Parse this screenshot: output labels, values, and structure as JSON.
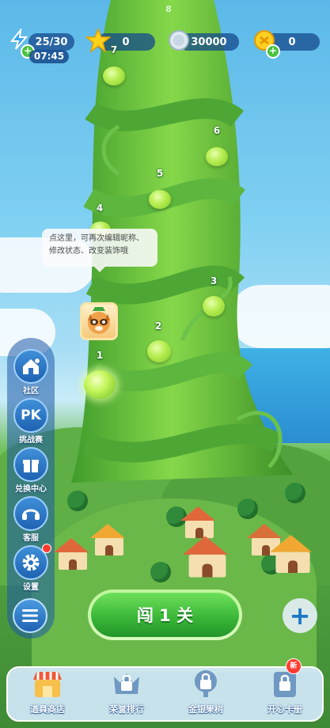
{
  "resources": {
    "energy": {
      "value": "25/30",
      "timer": "07:45",
      "icon": "lightning-icon"
    },
    "stars": {
      "value": "0",
      "icon": "star-icon"
    },
    "silver": {
      "value": "30000",
      "icon": "silver-coin-icon"
    },
    "gold": {
      "value": "0",
      "icon": "gold-coin-icon"
    }
  },
  "levels": [
    {
      "number": "1",
      "state": "current"
    },
    {
      "number": "2",
      "state": "locked"
    },
    {
      "number": "3",
      "state": "locked"
    },
    {
      "number": "4",
      "state": "locked"
    },
    {
      "number": "5",
      "state": "locked"
    },
    {
      "number": "6",
      "state": "locked"
    },
    {
      "number": "7",
      "state": "locked"
    },
    {
      "number": "8",
      "state": "locked"
    }
  ],
  "tooltip": {
    "line1": "点这里，可再次编辑昵称、",
    "line2": "修改状态、改变装饰哦"
  },
  "side_menu": [
    {
      "label": "社区",
      "icon": "community-house-icon"
    },
    {
      "label": "挑战赛",
      "icon": "pk-icon"
    },
    {
      "label": "兑换中心",
      "icon": "gift-icon"
    },
    {
      "label": "客服",
      "icon": "headset-icon"
    },
    {
      "label": "设置",
      "icon": "gear-icon",
      "notification": true
    }
  ],
  "play_button": {
    "label": "闯 1 关"
  },
  "bottom_nav": [
    {
      "label": "道具商店",
      "icon": "shop-icon",
      "locked": false
    },
    {
      "label": "荣誉排行",
      "icon": "lock-icon",
      "locked": true
    },
    {
      "label": "金银果树",
      "icon": "lock-icon",
      "locked": true
    },
    {
      "label": "开心卡册",
      "icon": "lock-icon",
      "locked": true,
      "badge": "新"
    }
  ],
  "colors": {
    "accent_green": "#37b437",
    "panel_blue": "#1f63b3",
    "badge_red": "#ff3b30"
  }
}
